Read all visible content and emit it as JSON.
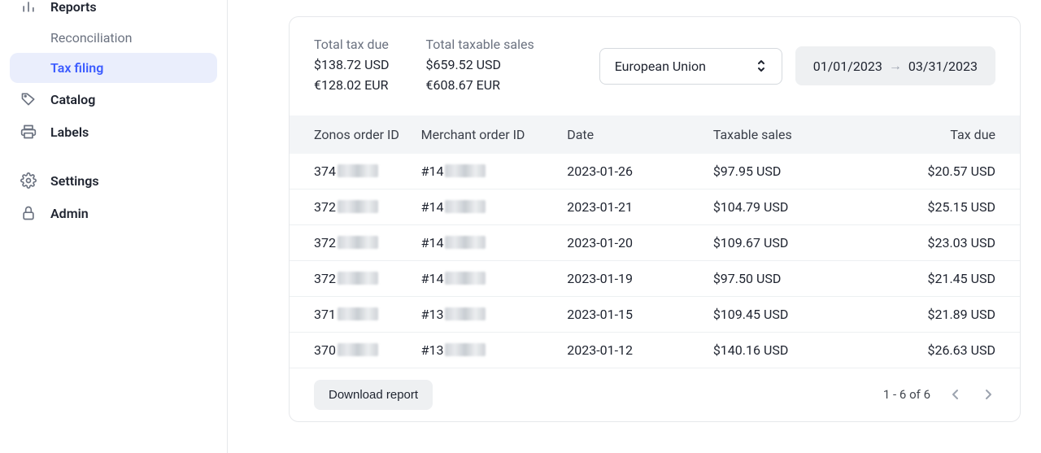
{
  "sidebar": {
    "reports": {
      "label": "Reports"
    },
    "reconciliation": {
      "label": "Reconciliation"
    },
    "tax_filing": {
      "label": "Tax filing"
    },
    "catalog": {
      "label": "Catalog"
    },
    "labels": {
      "label": "Labels"
    },
    "settings": {
      "label": "Settings"
    },
    "admin": {
      "label": "Admin"
    }
  },
  "summary": {
    "due_label": "Total tax due",
    "due_usd": "$138.72 USD",
    "due_eur": "€128.02 EUR",
    "sales_label": "Total taxable sales",
    "sales_usd": "$659.52 USD",
    "sales_eur": "€608.67 EUR"
  },
  "region_select": {
    "value": "European Union"
  },
  "date_range": {
    "from": "01/01/2023",
    "to": "03/31/2023"
  },
  "table": {
    "headers": {
      "zonos_id": "Zonos order ID",
      "merchant_id": "Merchant order ID",
      "date": "Date",
      "taxable_sales": "Taxable sales",
      "tax_due": "Tax due"
    },
    "rows": [
      {
        "zonos_prefix": "374",
        "merchant_prefix": "#14",
        "date": "2023-01-26",
        "sales": "$97.95 USD",
        "due": "$20.57 USD"
      },
      {
        "zonos_prefix": "372",
        "merchant_prefix": "#14",
        "date": "2023-01-21",
        "sales": "$104.79 USD",
        "due": "$25.15 USD"
      },
      {
        "zonos_prefix": "372",
        "merchant_prefix": "#14",
        "date": "2023-01-20",
        "sales": "$109.67 USD",
        "due": "$23.03 USD"
      },
      {
        "zonos_prefix": "372",
        "merchant_prefix": "#14",
        "date": "2023-01-19",
        "sales": "$97.50 USD",
        "due": "$21.45 USD"
      },
      {
        "zonos_prefix": "371",
        "merchant_prefix": "#13",
        "date": "2023-01-15",
        "sales": "$109.45 USD",
        "due": "$21.89 USD"
      },
      {
        "zonos_prefix": "370",
        "merchant_prefix": "#13",
        "date": "2023-01-12",
        "sales": "$140.16 USD",
        "due": "$26.63 USD"
      }
    ]
  },
  "footer": {
    "download_label": "Download report",
    "page_info": "1 - 6 of 6"
  }
}
